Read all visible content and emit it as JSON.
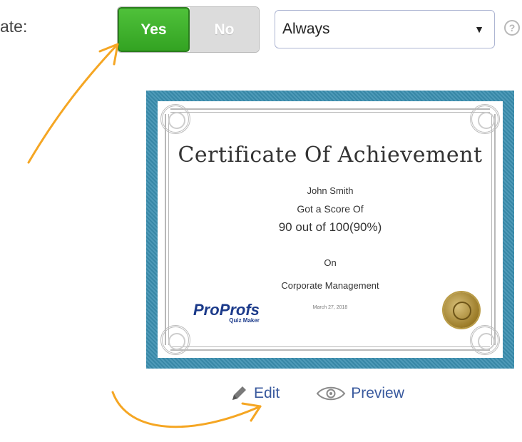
{
  "setting": {
    "label": "ate:",
    "toggle_yes": "Yes",
    "toggle_no": "No",
    "selected_toggle": "Yes",
    "dropdown_value": "Always",
    "help_symbol": "?"
  },
  "certificate": {
    "title": "Certificate Of Achievement",
    "name": "John Smith",
    "score_prefix": "Got a Score Of",
    "score": "90 out of 100(90%)",
    "on_label": "On",
    "course": "Corporate Management",
    "date": "March 27, 2018",
    "logo_text": "ProProfs",
    "logo_subtext": "Quiz Maker"
  },
  "actions": {
    "edit_label": "Edit",
    "preview_label": "Preview"
  },
  "colors": {
    "accent_green": "#3bb12a",
    "frame_blue": "#3a8fb0",
    "link_blue": "#3a5a9e",
    "arrow_orange": "#f5a623"
  },
  "icons": {
    "edit": "pencil-icon",
    "preview": "eye-icon",
    "help": "help-circle-icon",
    "caret": "caret-down-icon"
  }
}
